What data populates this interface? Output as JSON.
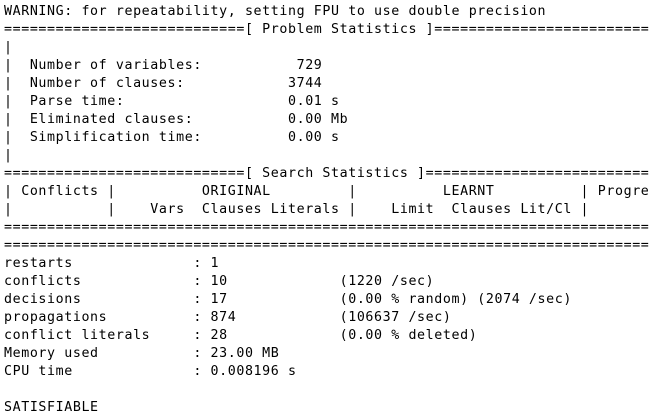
{
  "console": {
    "lines": [
      "WARNING: for repeatability, setting FPU to use double precision",
      "============================[ Problem Statistics ]=============================",
      "|                                                                             |",
      "|  Number of variables:           729                                         |",
      "|  Number of clauses:            3744                                         |",
      "|  Parse time:                   0.01 s                                       |",
      "|  Eliminated clauses:           0.00 Mb                                      |",
      "|  Simplification time:          0.00 s                                       |",
      "|                                                                             |",
      "============================[ Search Statistics ]==============================",
      "| Conflicts |          ORIGINAL         |          LEARNT          | Progress |",
      "|           |    Vars  Clauses Literals |    Limit  Clauses Lit/Cl |          |",
      "===============================================================================",
      "===============================================================================",
      "restarts              : 1",
      "conflicts             : 10             (1220 /sec)",
      "decisions             : 17             (0.00 % random) (2074 /sec)",
      "propagations          : 874            (106637 /sec)",
      "conflict literals     : 28             (0.00 % deleted)",
      "Memory used           : 23.00 MB",
      "CPU time              : 0.008196 s",
      "",
      "SATISFIABLE"
    ]
  }
}
